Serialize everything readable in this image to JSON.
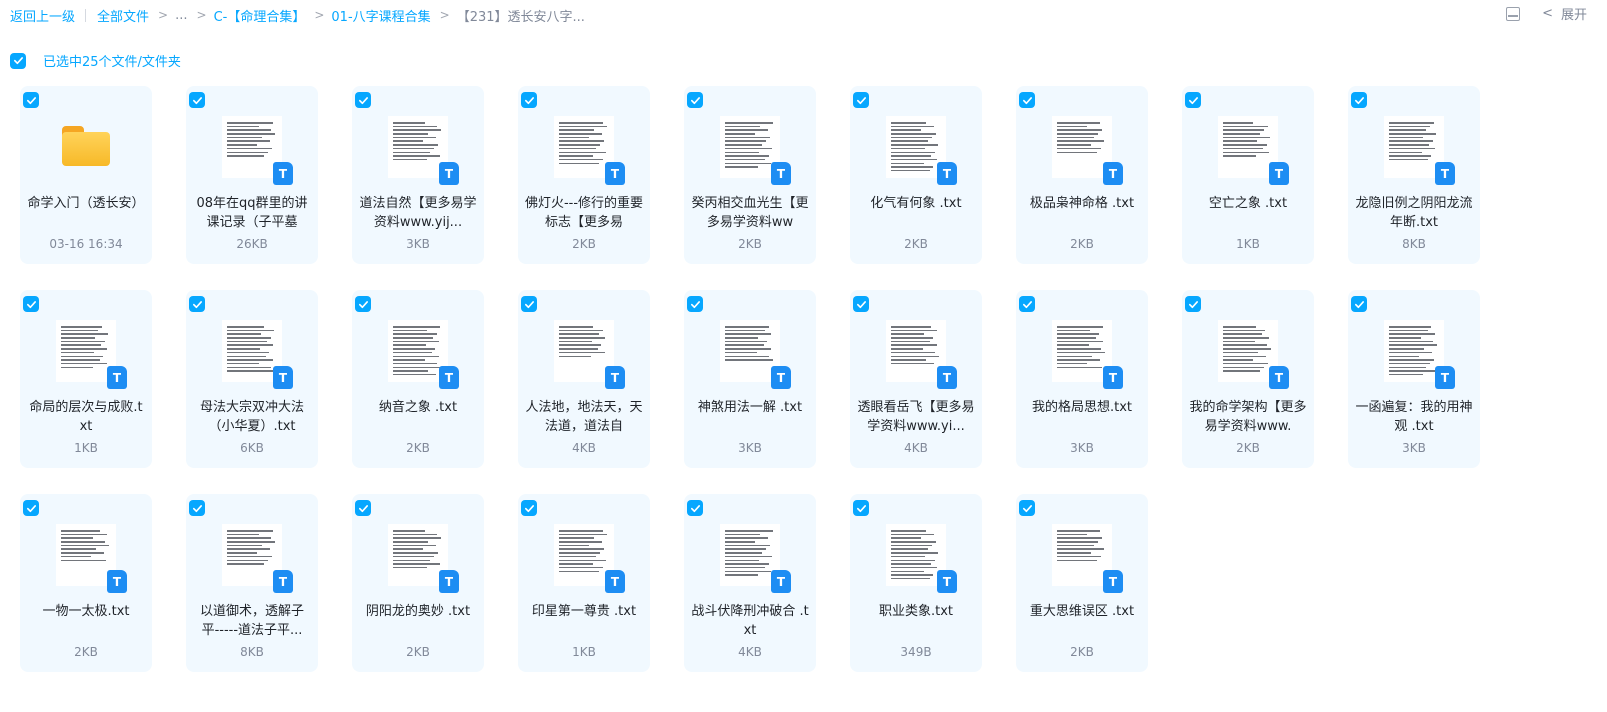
{
  "breadcrumb": {
    "back": "返回上一级",
    "root": "全部文件",
    "ellipsis": "...",
    "level1": "C-【命理合集】",
    "level2": "01-八字课程合集",
    "current": "【231】透长安八字..."
  },
  "top_right": {
    "panel_icon": "panel-toggle-icon",
    "expand_label": "展开"
  },
  "selection": {
    "label": "已选中25个文件/文件夹",
    "checked": true
  },
  "accent_color": "#06a7ff",
  "files": [
    {
      "type": "folder",
      "name": "命学入门（透长安）",
      "meta": "03-16 16:34"
    },
    {
      "type": "txt",
      "name": "08年在qq群里的讲课记录（子平墓",
      "meta": "26KB"
    },
    {
      "type": "txt",
      "name": "道法自然【更多易学资料www.yij...",
      "meta": "3KB"
    },
    {
      "type": "txt",
      "name": "佛灯火---修行的重要标志【更多易",
      "meta": "2KB"
    },
    {
      "type": "txt",
      "name": "癸丙相交血光生【更多易学资料ww",
      "meta": "2KB"
    },
    {
      "type": "txt",
      "name": "化气有何象 .txt",
      "meta": "2KB"
    },
    {
      "type": "txt",
      "name": "极品枭神命格 .txt",
      "meta": "2KB"
    },
    {
      "type": "txt",
      "name": "空亡之象 .txt",
      "meta": "1KB"
    },
    {
      "type": "txt",
      "name": "龙隐旧例之阴阳龙流年断.txt",
      "meta": "8KB"
    },
    {
      "type": "txt",
      "name": "命局的层次与成败.txt",
      "meta": "1KB"
    },
    {
      "type": "txt",
      "name": "母法大宗双冲大法（小华夏）.txt",
      "meta": "6KB"
    },
    {
      "type": "txt",
      "name": "纳音之象 .txt",
      "meta": "2KB"
    },
    {
      "type": "txt",
      "name": "人法地，地法天，天法道，道法自",
      "meta": "4KB"
    },
    {
      "type": "txt",
      "name": "神煞用法一解 .txt",
      "meta": "3KB"
    },
    {
      "type": "txt",
      "name": "透眼看岳飞【更多易学资料www.yi...",
      "meta": "4KB"
    },
    {
      "type": "txt",
      "name": "我的格局思想.txt",
      "meta": "3KB"
    },
    {
      "type": "txt",
      "name": "我的命学架构【更多易学资料www.",
      "meta": "2KB"
    },
    {
      "type": "txt",
      "name": "一函遍复：我的用神观 .txt",
      "meta": "3KB"
    },
    {
      "type": "txt",
      "name": "一物一太极.txt",
      "meta": "2KB"
    },
    {
      "type": "txt",
      "name": "以道御术，透解子平-----道法子平...",
      "meta": "8KB"
    },
    {
      "type": "txt",
      "name": "阴阳龙的奥妙 .txt",
      "meta": "2KB"
    },
    {
      "type": "txt",
      "name": "印星第一尊贵 .txt",
      "meta": "1KB"
    },
    {
      "type": "txt",
      "name": "战斗伏降刑冲破合 .txt",
      "meta": "4KB"
    },
    {
      "type": "txt",
      "name": "职业类象.txt",
      "meta": "349B"
    },
    {
      "type": "txt",
      "name": "重大思维误区 .txt",
      "meta": "2KB"
    }
  ]
}
